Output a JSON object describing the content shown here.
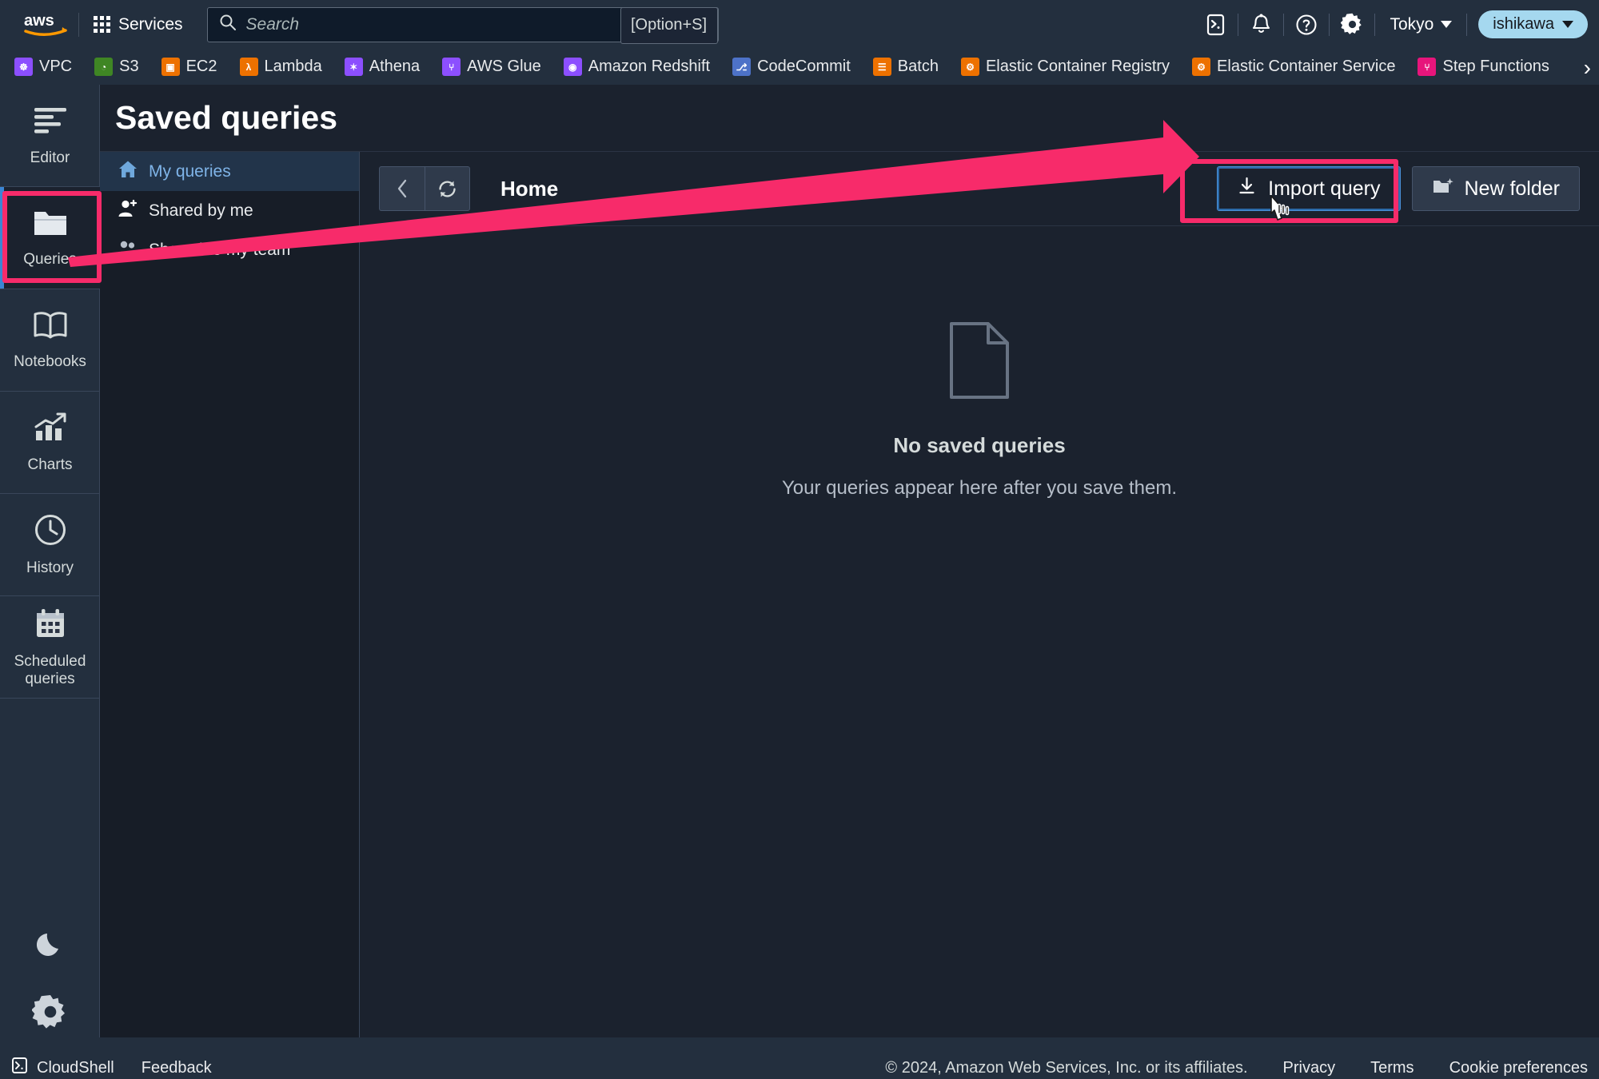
{
  "topnav": {
    "logo_alt": "aws",
    "services_label": "Services",
    "search_placeholder": "Search",
    "search_value": "",
    "search_shortcut": "[Option+S]",
    "icons": [
      "cloudshell-icon",
      "notifications-bell-icon",
      "help-question-icon",
      "settings-gear-icon"
    ],
    "region_label": "Tokyo",
    "user_label": "ishikawa"
  },
  "service_bar": {
    "items": [
      {
        "label": "VPC",
        "color": "#8c4fff",
        "glyph": "☸"
      },
      {
        "label": "S3",
        "color": "#3f8624",
        "glyph": "◔"
      },
      {
        "label": "EC2",
        "color": "#ed7100",
        "glyph": "▣"
      },
      {
        "label": "Lambda",
        "color": "#ed7100",
        "glyph": "λ"
      },
      {
        "label": "Athena",
        "color": "#8c4fff",
        "glyph": "✶"
      },
      {
        "label": "AWS Glue",
        "color": "#8c4fff",
        "glyph": "⑂"
      },
      {
        "label": "Amazon Redshift",
        "color": "#8c4fff",
        "glyph": "◉"
      },
      {
        "label": "CodeCommit",
        "color": "#4d72c8",
        "glyph": "⎇"
      },
      {
        "label": "Batch",
        "color": "#ed7100",
        "glyph": "☰"
      },
      {
        "label": "Elastic Container Registry",
        "color": "#ed7100",
        "glyph": "⚙"
      },
      {
        "label": "Elastic Container Service",
        "color": "#ed7100",
        "glyph": "⚙"
      },
      {
        "label": "Step Functions",
        "color": "#e7157b",
        "glyph": "⑂"
      }
    ],
    "more_icon": "chevron-right-icon"
  },
  "rail": {
    "items": [
      {
        "label": "Editor",
        "icon": "editor-lines-icon",
        "selected": false
      },
      {
        "label": "Queries",
        "icon": "folder-icon",
        "selected": true
      },
      {
        "label": "Notebooks",
        "icon": "book-icon",
        "selected": false
      },
      {
        "label": "Charts",
        "icon": "bar-chart-icon",
        "selected": false
      },
      {
        "label": "History",
        "icon": "clock-icon",
        "selected": false
      },
      {
        "label": "Scheduled queries",
        "icon": "calendar-icon",
        "selected": false
      }
    ],
    "bottom_icons": [
      {
        "name": "dark-mode-moon-icon"
      },
      {
        "name": "settings-gear-icon"
      }
    ]
  },
  "page": {
    "title": "Saved queries"
  },
  "tree": {
    "items": [
      {
        "label": "My queries",
        "icon": "home-icon",
        "active": true
      },
      {
        "label": "Shared by me",
        "icon": "user-share-icon",
        "active": false
      },
      {
        "label": "Shared to my team",
        "icon": "team-share-icon",
        "active": false
      }
    ]
  },
  "toolbar": {
    "back_icon": "chevron-left-icon",
    "refresh_icon": "refresh-icon",
    "breadcrumb": "Home",
    "import_label": "Import query",
    "import_icon": "download-icon",
    "new_folder_label": "New folder",
    "new_folder_icon": "new-folder-icon"
  },
  "empty_state": {
    "icon": "document-page-icon",
    "title": "No saved queries",
    "subtitle": "Your queries appear here after you save them."
  },
  "footer": {
    "cloudshell_label": "CloudShell",
    "cloudshell_icon": "cloudshell-icon",
    "feedback_label": "Feedback",
    "copyright": "© 2024, Amazon Web Services, Inc. or its affiliates.",
    "privacy_label": "Privacy",
    "terms_label": "Terms",
    "cookie_label": "Cookie preferences"
  },
  "annotations": {
    "highlight_color": "#f72b6a",
    "boxes": [
      "queries-rail-item",
      "import-query-button"
    ],
    "arrow": "points from Queries rail item to Import query button"
  }
}
